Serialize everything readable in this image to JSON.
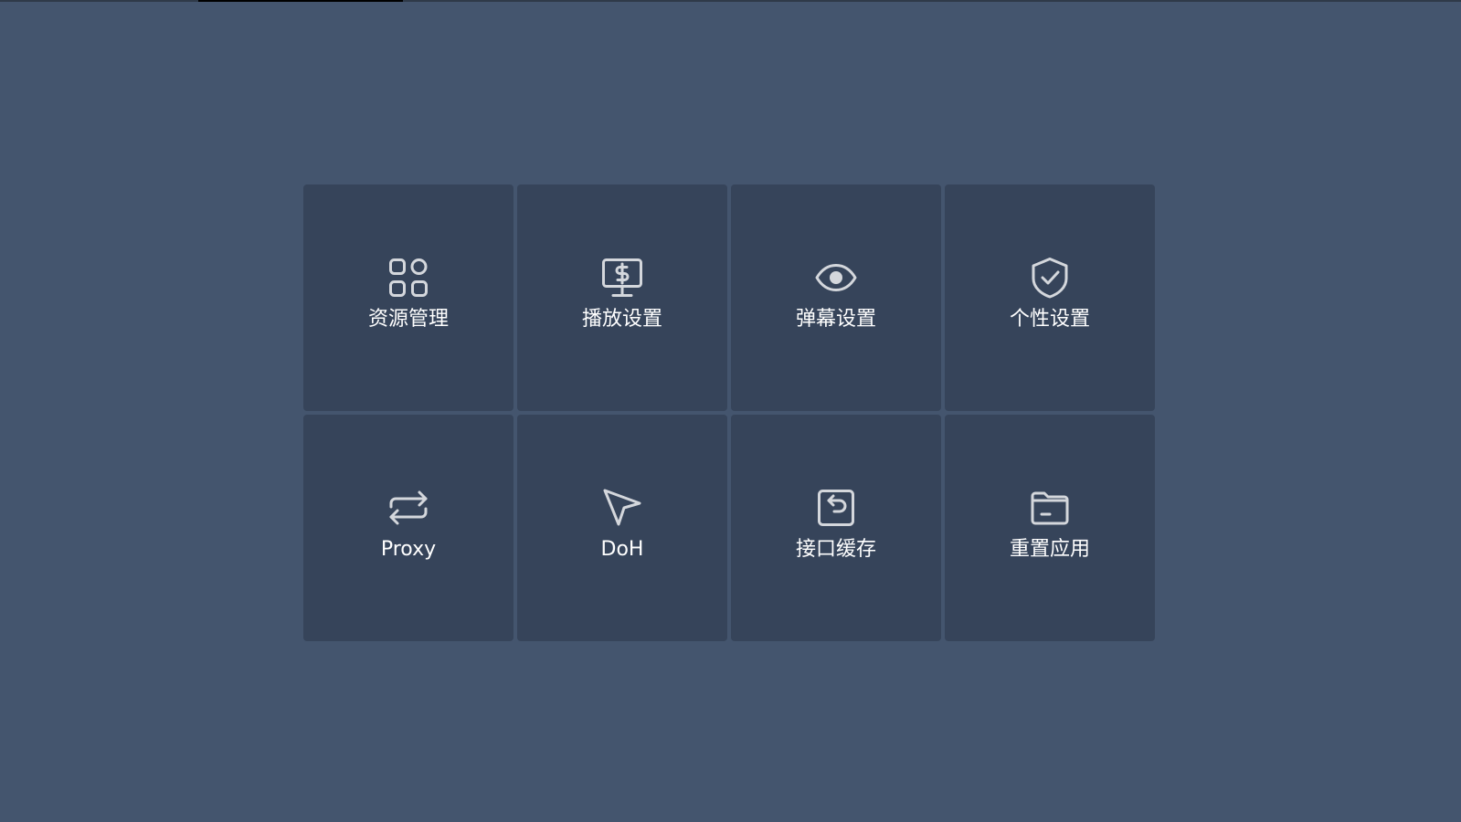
{
  "colors": {
    "background": "#44556e",
    "tile": "#36445a",
    "icon": "#d4d7dc",
    "label": "#ffffff"
  },
  "menu": {
    "items": [
      {
        "label": "资源管理",
        "icon": "apps-grid-icon"
      },
      {
        "label": "播放设置",
        "icon": "monitor-dollar-icon"
      },
      {
        "label": "弹幕设置",
        "icon": "eye-icon"
      },
      {
        "label": "个性设置",
        "icon": "shield-check-icon"
      },
      {
        "label": "Proxy",
        "icon": "repeat-arrows-icon"
      },
      {
        "label": "DoH",
        "icon": "cursor-arrow-icon"
      },
      {
        "label": "接口缓存",
        "icon": "undo-square-icon"
      },
      {
        "label": "重置应用",
        "icon": "folder-icon"
      }
    ]
  }
}
